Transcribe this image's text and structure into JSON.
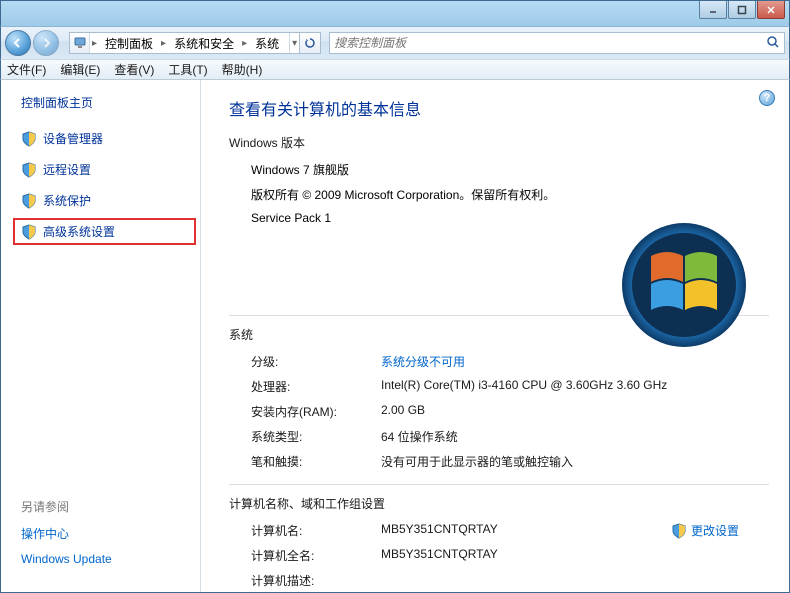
{
  "window": {
    "minimize": "–",
    "maximize": "□",
    "close": "×"
  },
  "nav": {
    "breadcrumb": [
      "控制面板",
      "系统和安全",
      "系统"
    ],
    "search_placeholder": "搜索控制面板"
  },
  "menu": {
    "file": "文件(F)",
    "edit": "编辑(E)",
    "view": "查看(V)",
    "tools": "工具(T)",
    "help": "帮助(H)"
  },
  "sidebar": {
    "home": "控制面板主页",
    "items": [
      {
        "label": "设备管理器"
      },
      {
        "label": "远程设置"
      },
      {
        "label": "系统保护"
      },
      {
        "label": "高级系统设置"
      }
    ],
    "seealso_label": "另请参阅",
    "seealso": [
      "操作中心",
      "Windows Update"
    ]
  },
  "content": {
    "title": "查看有关计算机的基本信息",
    "edition_heading": "Windows 版本",
    "edition_name": "Windows 7 旗舰版",
    "copyright": "版权所有 © 2009 Microsoft Corporation。保留所有权利。",
    "service_pack": "Service Pack 1",
    "system_heading": "系统",
    "rating_k": "分级:",
    "rating_v": "系统分级不可用",
    "cpu_k": "处理器:",
    "cpu_v": "Intel(R) Core(TM) i3-4160 CPU @ 3.60GHz   3.60 GHz",
    "ram_k": "安装内存(RAM):",
    "ram_v": "2.00 GB",
    "systype_k": "系统类型:",
    "systype_v": "64 位操作系统",
    "pen_k": "笔和触摸:",
    "pen_v": "没有可用于此显示器的笔或触控输入",
    "name_heading": "计算机名称、域和工作组设置",
    "cname_k": "计算机名:",
    "cname_v": "MB5Y351CNTQRTAY",
    "change_link": "更改设置",
    "cfull_k": "计算机全名:",
    "cfull_v": "MB5Y351CNTQRTAY",
    "cdesc_k": "计算机描述:"
  }
}
